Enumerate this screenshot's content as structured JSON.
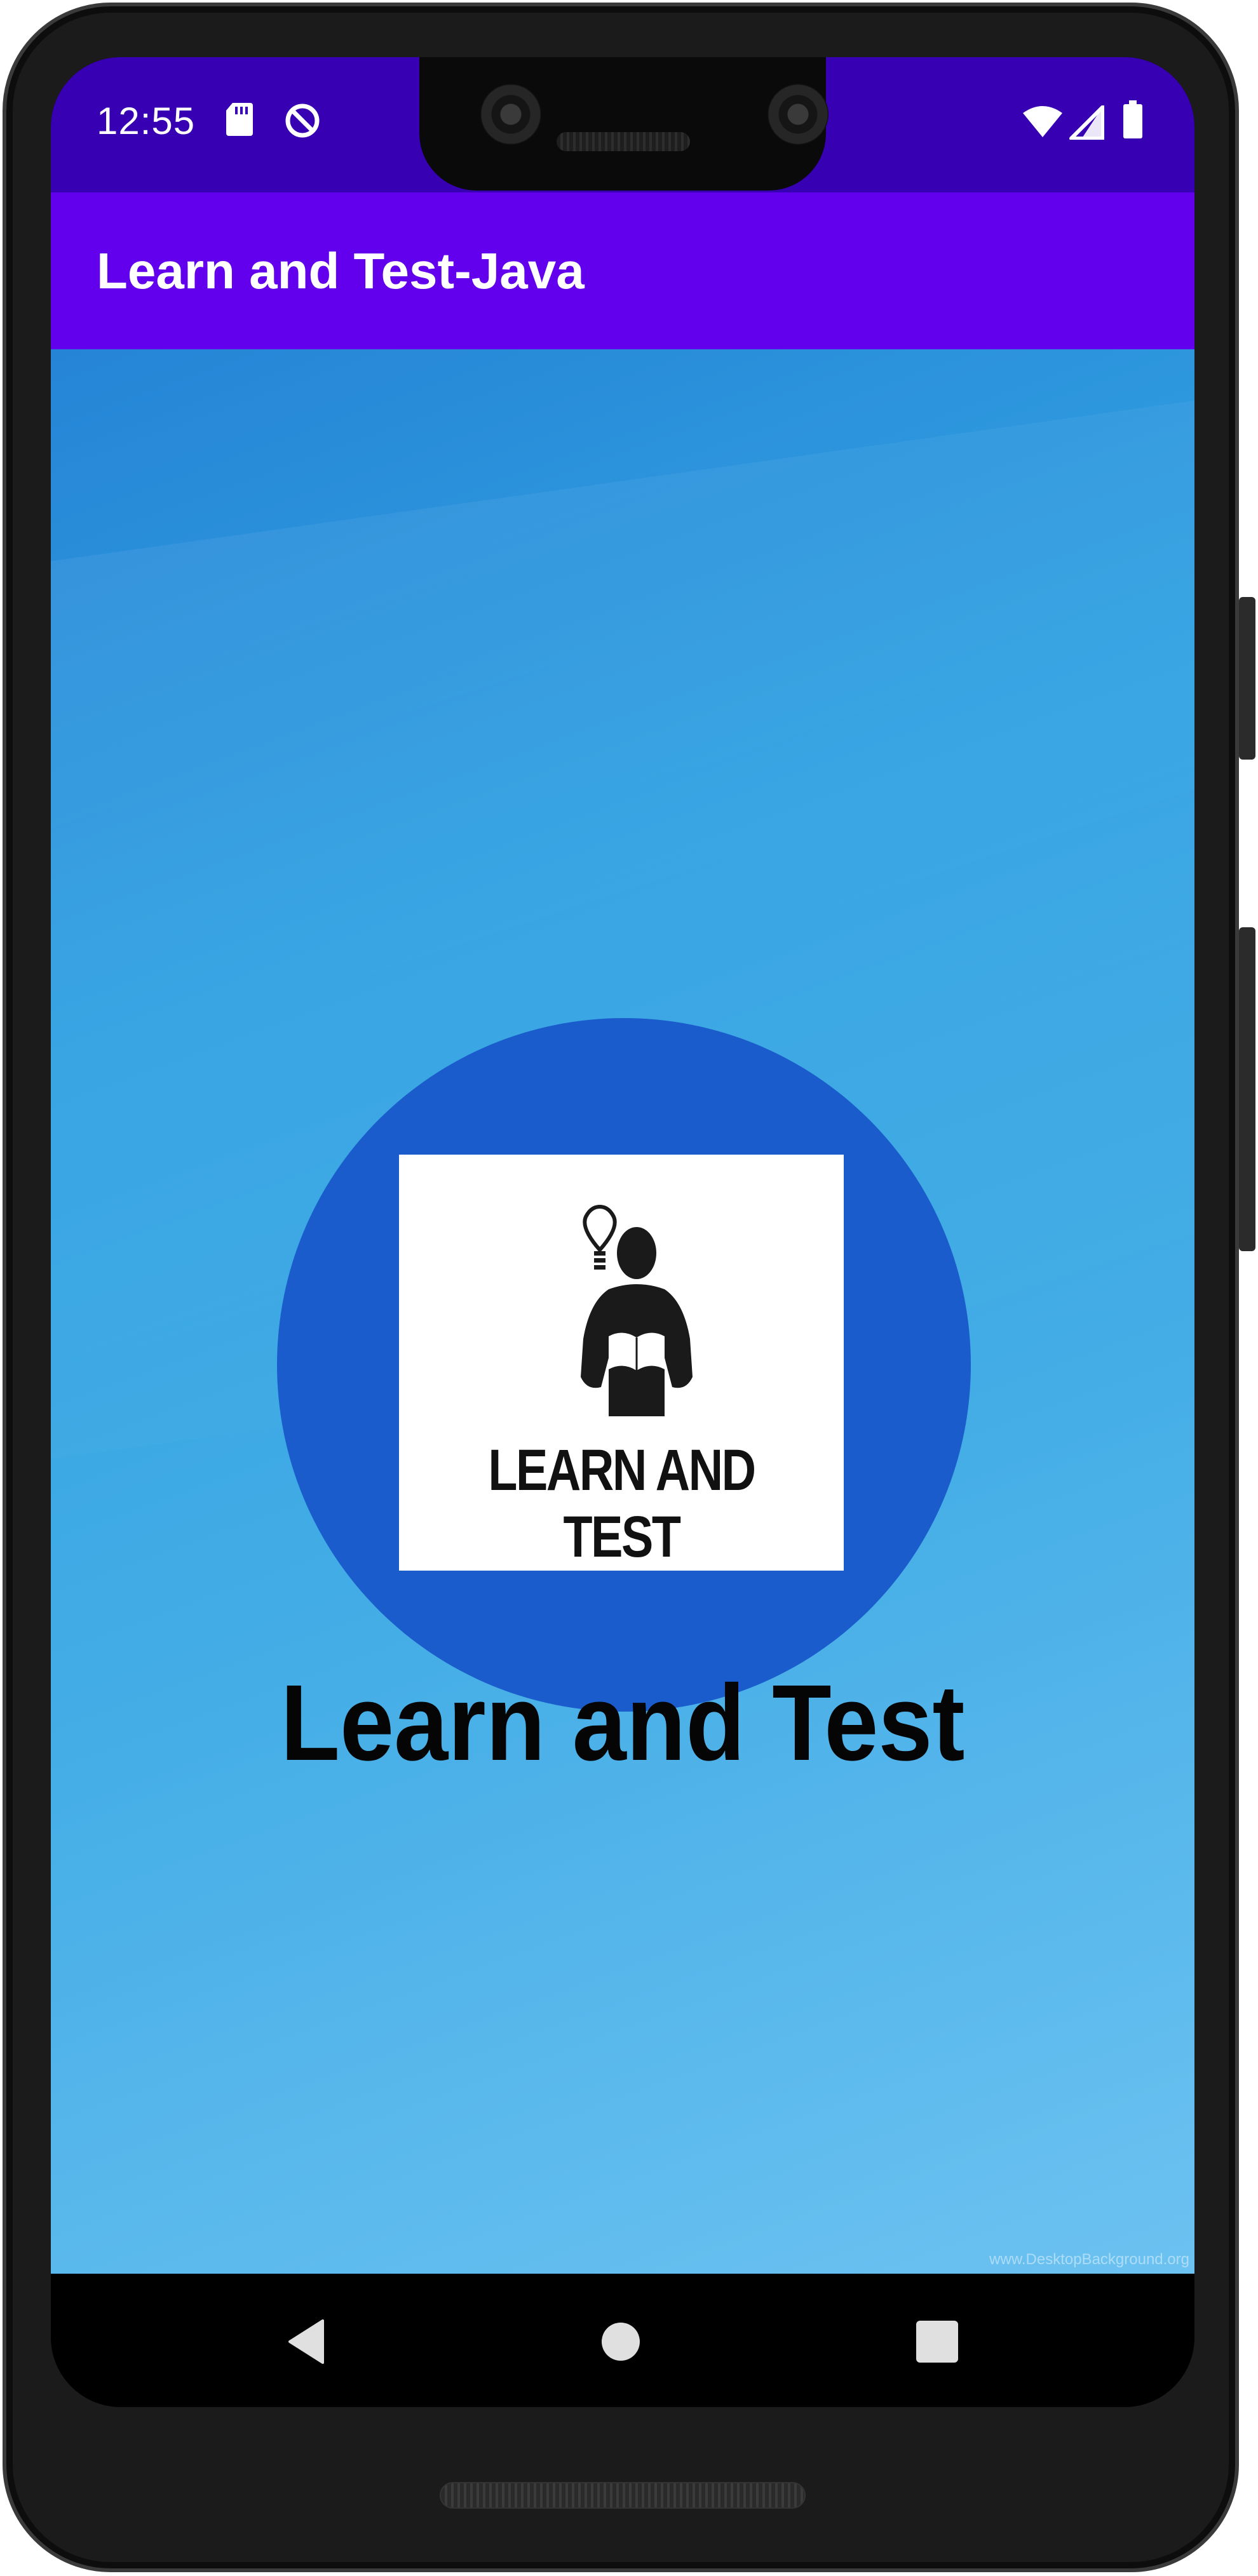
{
  "status_bar": {
    "time": "12:55",
    "left_icons": [
      "sd-card-icon",
      "data-saver-icon"
    ],
    "right_icons": [
      "wifi-icon",
      "cell-signal-icon",
      "battery-icon"
    ]
  },
  "app_bar": {
    "title": "Learn and Test-Java"
  },
  "main": {
    "logo_text": "LEARN AND TEST",
    "heading": "Learn and Test",
    "watermark": "www.DesktopBackground.org"
  },
  "nav_bar": {
    "buttons": [
      "back-icon",
      "home-icon",
      "recents-icon"
    ]
  },
  "colors": {
    "status_bar": "#3700b3",
    "app_bar": "#6200ee",
    "logo_circle": "#1a5ccc",
    "background_top": "#2584d6",
    "background_bottom": "#6cc2f1"
  }
}
